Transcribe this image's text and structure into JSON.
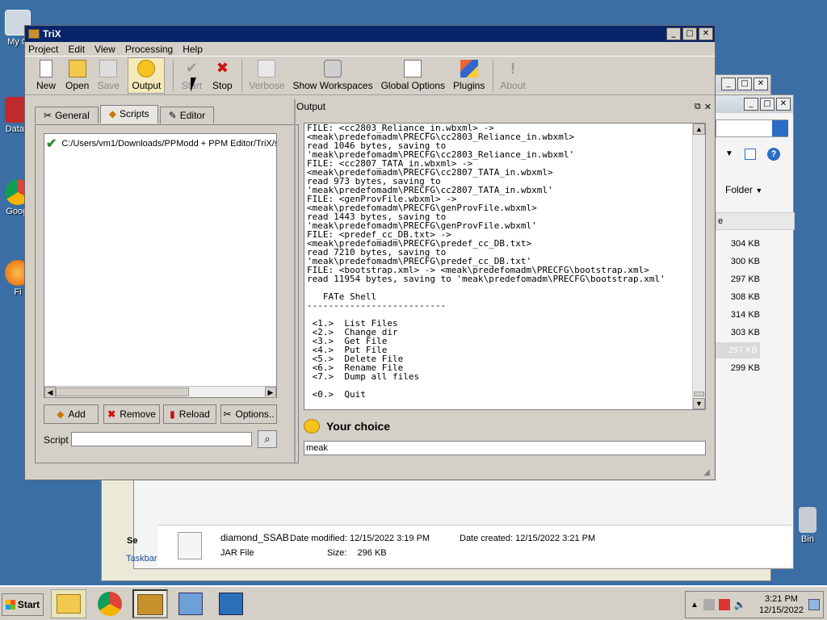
{
  "desktop": {
    "icons": [
      {
        "label": "My C"
      },
      {
        "label": "DataV"
      },
      {
        "label": "Googl"
      },
      {
        "label": "Fi"
      },
      {
        "label": "Bin"
      }
    ]
  },
  "trix": {
    "title": "TriX",
    "menu": [
      "Project",
      "Edit",
      "View",
      "Processing",
      "Help"
    ],
    "toolbar": {
      "new": "New",
      "open": "Open",
      "save": "Save",
      "output": "Output",
      "start": "Start",
      "stop": "Stop",
      "verbose": "Verbose",
      "show_workspaces": "Show Workspaces",
      "global_options": "Global Options",
      "plugins": "Plugins",
      "about": "About"
    },
    "tabs": {
      "general": "General",
      "scripts": "Scripts",
      "editor": "Editor"
    },
    "script_path": "C:/Users/vm1/Downloads/PPModd + PPM Editor/TriX/s",
    "buttons": {
      "add": "Add",
      "remove": "Remove",
      "reload": "Reload",
      "options": "Options.."
    },
    "script_label": "Script",
    "output_label": "Output",
    "output_lines": "FILE: <cc2803_Reliance_in.wbxml> ->\n<meak\\predefomadm\\PRECFG\\cc2803_Reliance_in.wbxml>\nread 1046 bytes, saving to\n'meak\\predefomadm\\PRECFG\\cc2803_Reliance_in.wbxml'\nFILE: <cc2807_TATA_in.wbxml> ->\n<meak\\predefomadm\\PRECFG\\cc2807_TATA_in.wbxml>\nread 973 bytes, saving to\n'meak\\predefomadm\\PRECFG\\cc2807_TATA_in.wbxml'\nFILE: <genProvFile.wbxml> ->\n<meak\\predefomadm\\PRECFG\\genProvFile.wbxml>\nread 1443 bytes, saving to\n'meak\\predefomadm\\PRECFG\\genProvFile.wbxml'\nFILE: <predef_cc_DB.txt> ->\n<meak\\predefomadm\\PRECFG\\predef_cc_DB.txt>\nread 7210 bytes, saving to\n'meak\\predefomadm\\PRECFG\\predef_cc_DB.txt'\nFILE: <bootstrap.xml> -> <meak\\predefomadm\\PRECFG\\bootstrap.xml>\nread 11954 bytes, saving to 'meak\\predefomadm\\PRECFG\\bootstrap.xml'\n\n   FATe Shell\n--------------------------\n\n <1.>  List Files\n <2.>  Change dir\n <3.>  Get File\n <4.>  Put File\n <5.>  Delete File\n <6.>  Rename File\n <7.>  Dump all files\n\n <0.>  Quit",
    "your_choice": "Your choice",
    "command_value": "meak"
  },
  "explorer": {
    "view_label": "Folder",
    "col_header": "e",
    "sizes": [
      "304 KB",
      "300 KB",
      "297 KB",
      "308 KB",
      "314 KB",
      "303 KB",
      "297 KB",
      "299 KB"
    ],
    "left_labels": [
      "Se",
      "Taskbar"
    ],
    "detail": {
      "name": "diamond_SSAB",
      "type": "JAR File",
      "modified_label": "Date modified:",
      "modified": "12/15/2022 3:19 PM",
      "created_label": "Date created:",
      "created": "12/15/2022 3:21 PM",
      "size_label": "Size:",
      "size": "296 KB"
    }
  },
  "taskbar": {
    "start": "Start",
    "time": "3:21 PM",
    "date": "12/15/2022"
  }
}
